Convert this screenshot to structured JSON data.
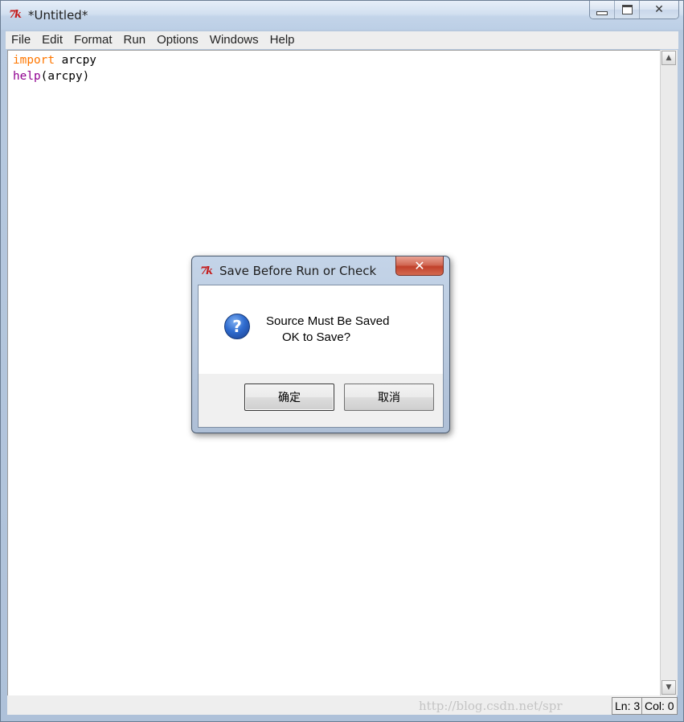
{
  "window": {
    "title": "*Untitled*",
    "app_icon": "tk-feather-icon",
    "minimize_glyph": "minimize-icon",
    "maximize_glyph": "maximize-icon",
    "close_glyph": "✕"
  },
  "menu": {
    "items": [
      "File",
      "Edit",
      "Format",
      "Run",
      "Options",
      "Windows",
      "Help"
    ]
  },
  "editor": {
    "lines": [
      {
        "keyword": "import",
        "rest": " arcpy",
        "keyword_color": "#ff7700"
      },
      {
        "keyword": "help",
        "rest": "(arcpy)",
        "keyword_color": "#900090"
      }
    ]
  },
  "status": {
    "line": "Ln: 3",
    "col": "Col: 0",
    "watermark": "http://blog.csdn.net/spr"
  },
  "dialog": {
    "title": "Save Before Run or Check",
    "close_glyph": "✕",
    "icon": "question-icon",
    "icon_glyph": "?",
    "message_line1": "Source Must Be Saved",
    "message_line2": "OK to Save?",
    "ok_label": "确定",
    "cancel_label": "取消"
  }
}
